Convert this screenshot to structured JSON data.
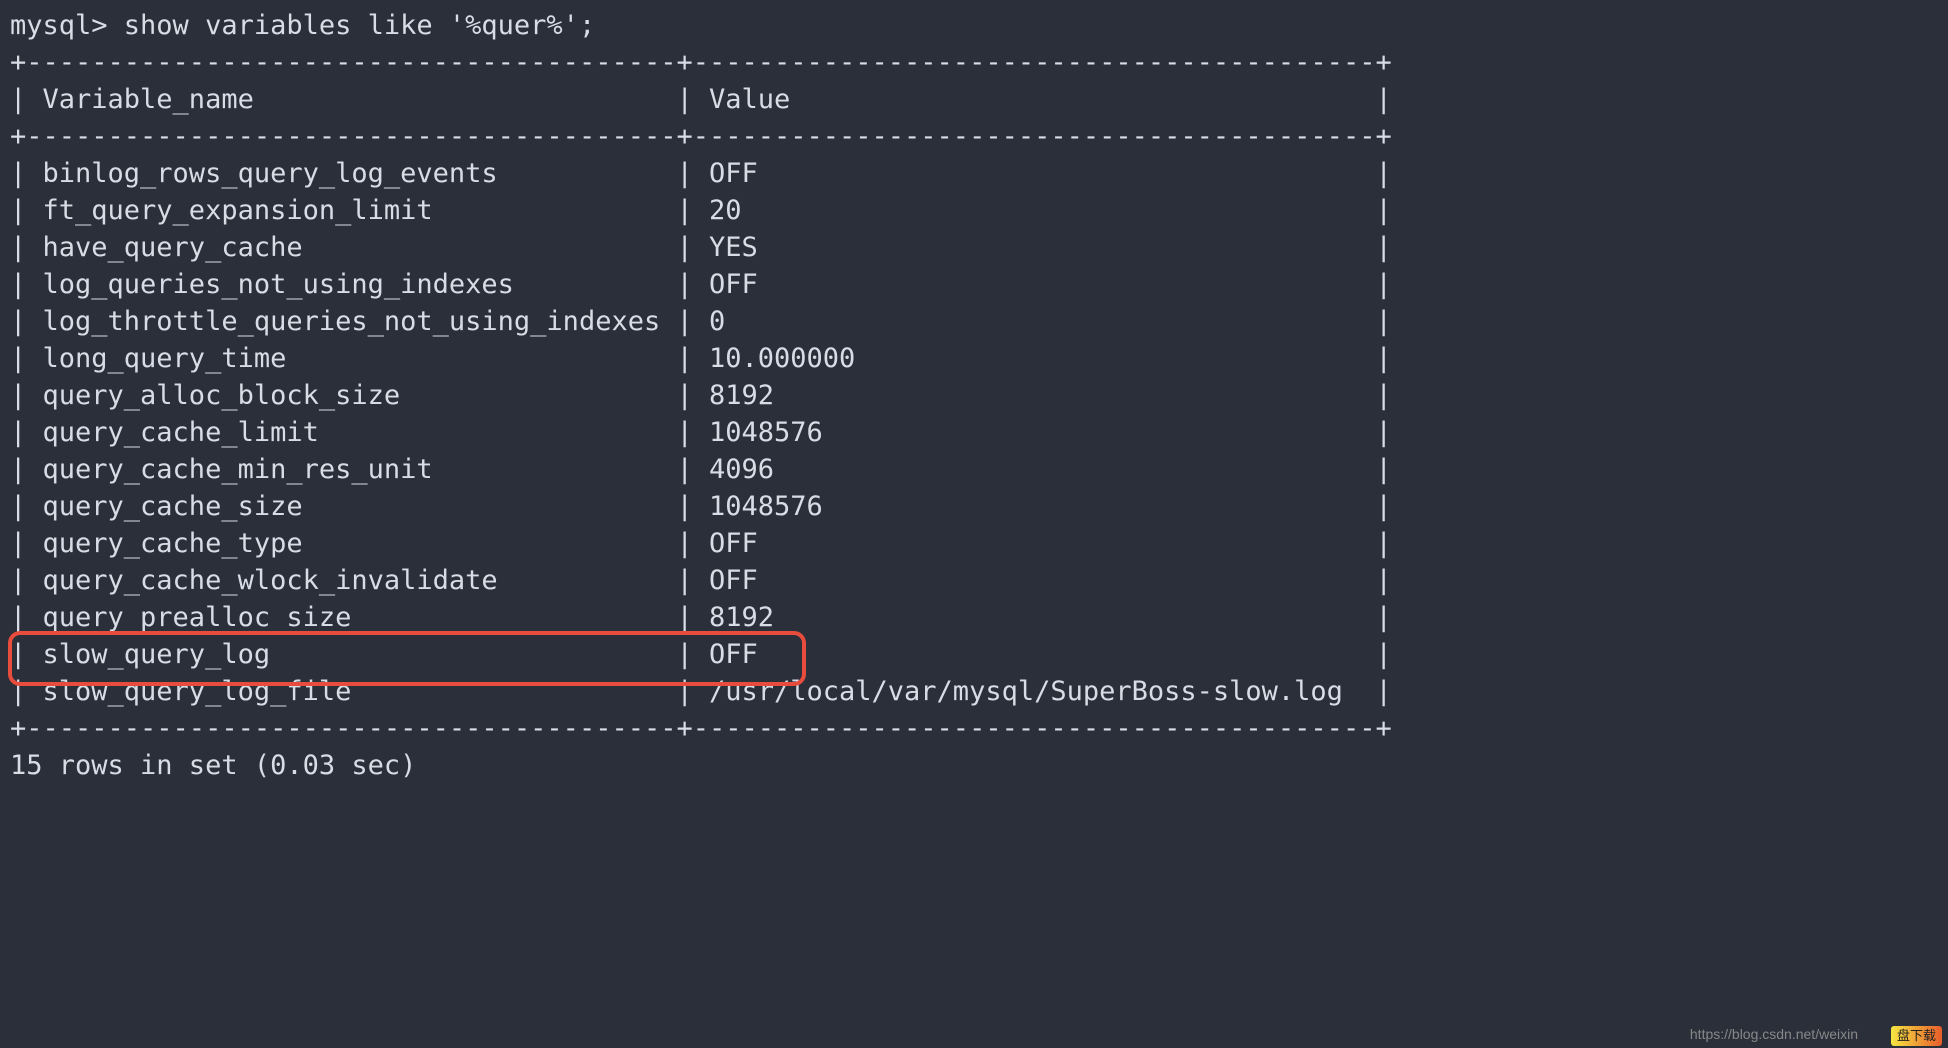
{
  "prompt": "mysql> ",
  "command": "show variables like '%quer%';",
  "headers": {
    "col1": "Variable_name",
    "col2": "Value"
  },
  "rows": [
    {
      "name": "binlog_rows_query_log_events",
      "value": "OFF"
    },
    {
      "name": "ft_query_expansion_limit",
      "value": "20"
    },
    {
      "name": "have_query_cache",
      "value": "YES"
    },
    {
      "name": "log_queries_not_using_indexes",
      "value": "OFF"
    },
    {
      "name": "log_throttle_queries_not_using_indexes",
      "value": "0"
    },
    {
      "name": "long_query_time",
      "value": "10.000000"
    },
    {
      "name": "query_alloc_block_size",
      "value": "8192"
    },
    {
      "name": "query_cache_limit",
      "value": "1048576"
    },
    {
      "name": "query_cache_min_res_unit",
      "value": "4096"
    },
    {
      "name": "query_cache_size",
      "value": "1048576"
    },
    {
      "name": "query_cache_type",
      "value": "OFF"
    },
    {
      "name": "query_cache_wlock_invalidate",
      "value": "OFF"
    },
    {
      "name": "query_prealloc_size",
      "value": "8192"
    },
    {
      "name": "slow_query_log",
      "value": "OFF"
    },
    {
      "name": "slow_query_log_file",
      "value": "/usr/local/var/mysql/SuperBoss-slow.log"
    }
  ],
  "footer": "15 rows in set (0.03 sec)",
  "col1_width": 38,
  "col2_width": 40,
  "highlight_row_index": 13,
  "watermark": "https://blog.csdn.net/weixin",
  "badge": "盘下载"
}
